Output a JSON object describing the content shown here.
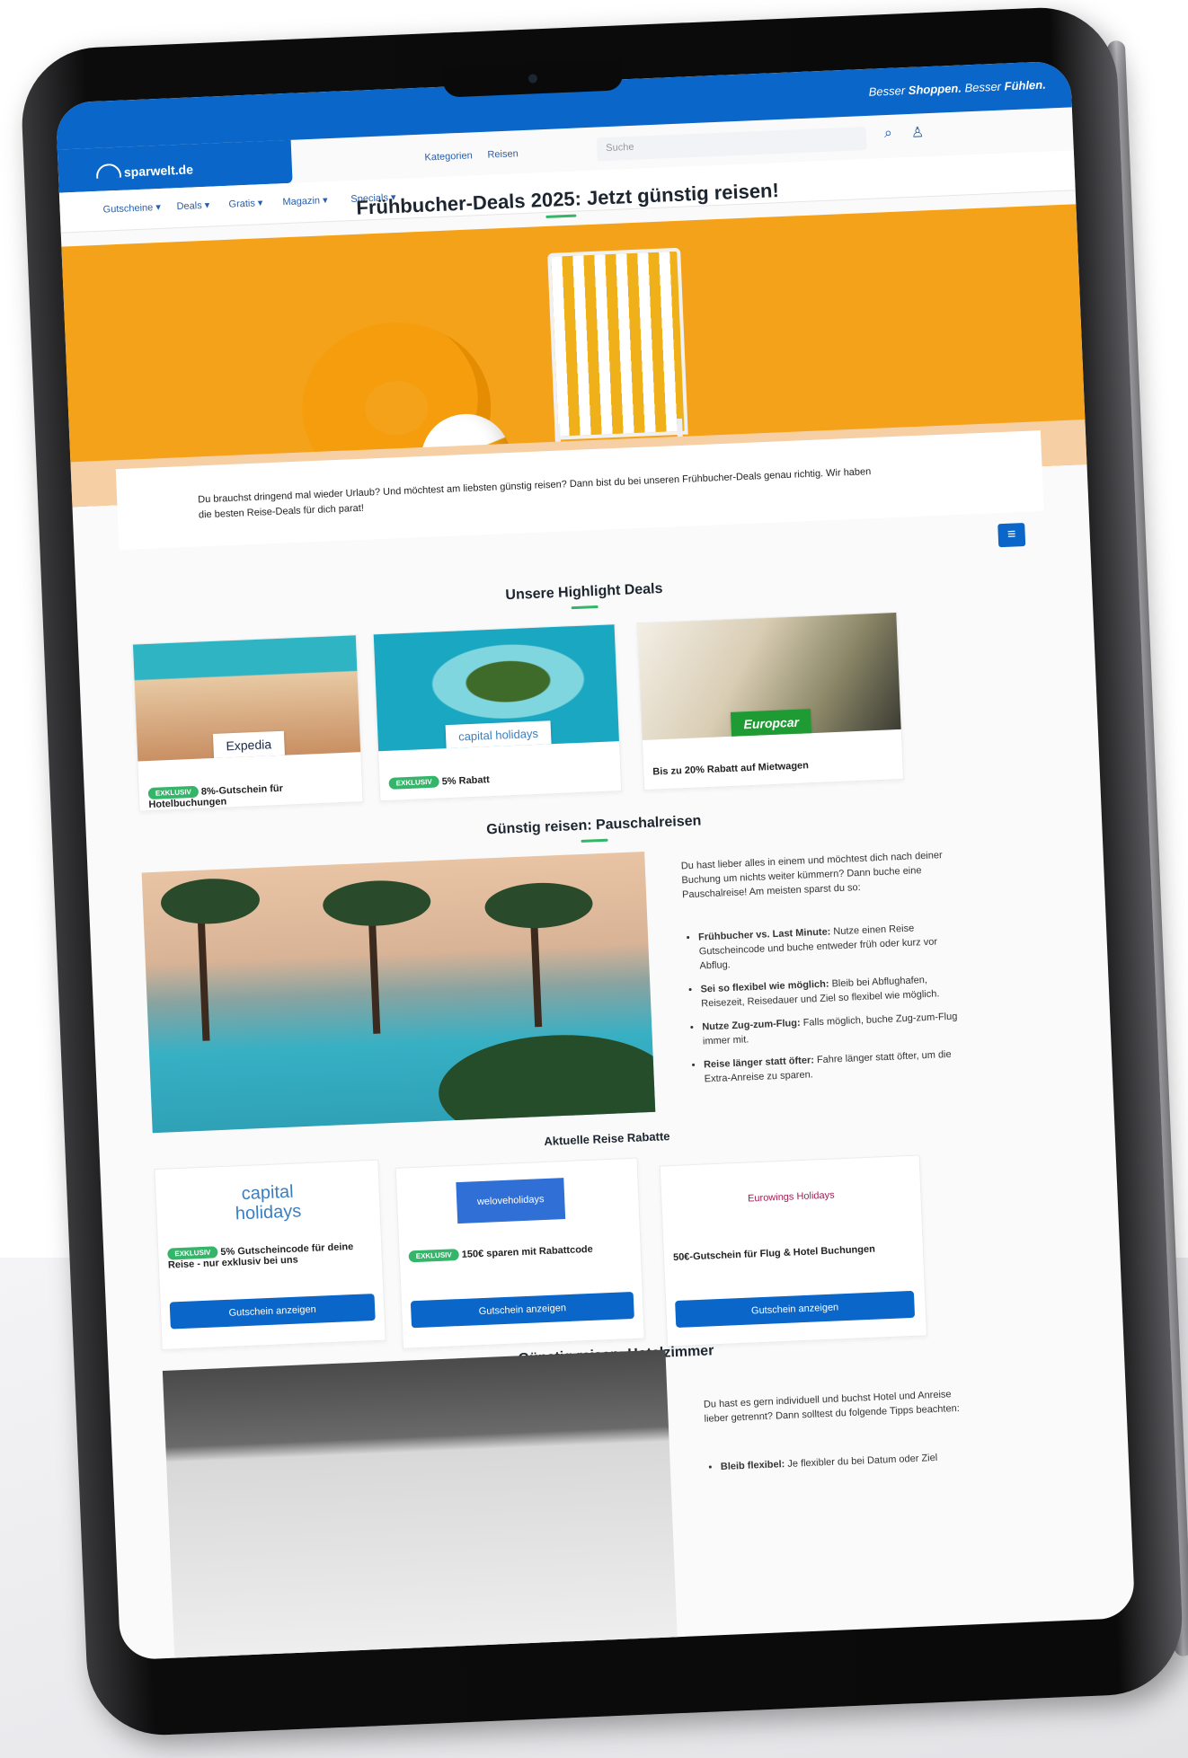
{
  "header": {
    "tagline_part1": "Besser",
    "tagline_bold1": "Shoppen.",
    "tagline_part2": "Besser",
    "tagline_bold2": "Fühlen.",
    "logo": "sparwelt.de",
    "search_placeholder": "Suche",
    "links": [
      "Kategorien",
      "Reisen"
    ],
    "nav": [
      "Gutscheine",
      "Deals",
      "Gratis",
      "Magazin",
      "Specials"
    ]
  },
  "page_title": "Frühbucher-Deals 2025: Jetzt günstig reisen!",
  "intro": "Du brauchst dringend mal wieder Urlaub? Und möchtest am liebsten günstig reisen? Dann bist du bei unseren Frühbucher-Deals genau richtig. Wir haben die besten Reise-Deals für dich parat!",
  "highlights": {
    "title": "Unsere Highlight Deals",
    "cards": [
      {
        "brand": "Expedia",
        "badge": "EXKLUSIV",
        "text": "8%-Gutschein für Hotelbuchungen"
      },
      {
        "brand": "capital holidays",
        "badge": "EXKLUSIV",
        "text": "5% Rabatt"
      },
      {
        "brand": "Europcar",
        "badge": "",
        "text": "Bis zu 20% Rabatt auf Mietwagen"
      }
    ]
  },
  "pauschal": {
    "title": "Günstig reisen: Pauschalreisen",
    "intro": "Du hast lieber alles in einem und möchtest dich nach deiner Buchung um nichts weiter kümmern? Dann buche eine Pauschalreise! Am meisten sparst du so:",
    "tips": [
      {
        "bold": "Frühbucher vs. Last Minute:",
        "text": " Nutze einen Reise Gutscheincode und buche entweder früh oder kurz vor Abflug."
      },
      {
        "bold": "Sei so flexibel wie möglich:",
        "text": " Bleib bei Abflughafen, Reisezeit, Reisedauer und Ziel so flexibel wie möglich."
      },
      {
        "bold": "Nutze Zug-zum-Flug:",
        "text": " Falls möglich, buche Zug-zum-Flug immer mit."
      },
      {
        "bold": "Reise länger statt öfter:",
        "text": " Fahre länger statt öfter, um die Extra-Anreise zu sparen."
      }
    ]
  },
  "rabatte": {
    "title": "Aktuelle Reise Rabatte",
    "cards": [
      {
        "brand_line1": "capital",
        "brand_line2": "holidays",
        "badge": "EXKLUSIV",
        "text": "5% Gutscheincode für deine Reise - nur exklusiv bei uns",
        "button": "Gutschein anzeigen"
      },
      {
        "brand": "weloveholidays",
        "badge": "EXKLUSIV",
        "text": "150€ sparen mit Rabattcode",
        "button": "Gutschein anzeigen"
      },
      {
        "brand": "Eurowings Holidays",
        "badge": "",
        "text": "50€-Gutschein für Flug & Hotel Buchungen",
        "button": "Gutschein anzeigen"
      }
    ]
  },
  "hotel": {
    "title": "Günstig reisen: Hotelzimmer",
    "intro": "Du hast es gern individuell und buchst Hotel und Anreise lieber getrennt? Dann solltest du folgende Tipps beachten:",
    "tip_bold": "Bleib flexibel:",
    "tip_text": " Je flexibler du bei Datum oder Ziel"
  },
  "colors": {
    "brand_blue": "#0a66c8",
    "accent_green": "#34b56a",
    "hero_orange": "#f5a21b"
  }
}
